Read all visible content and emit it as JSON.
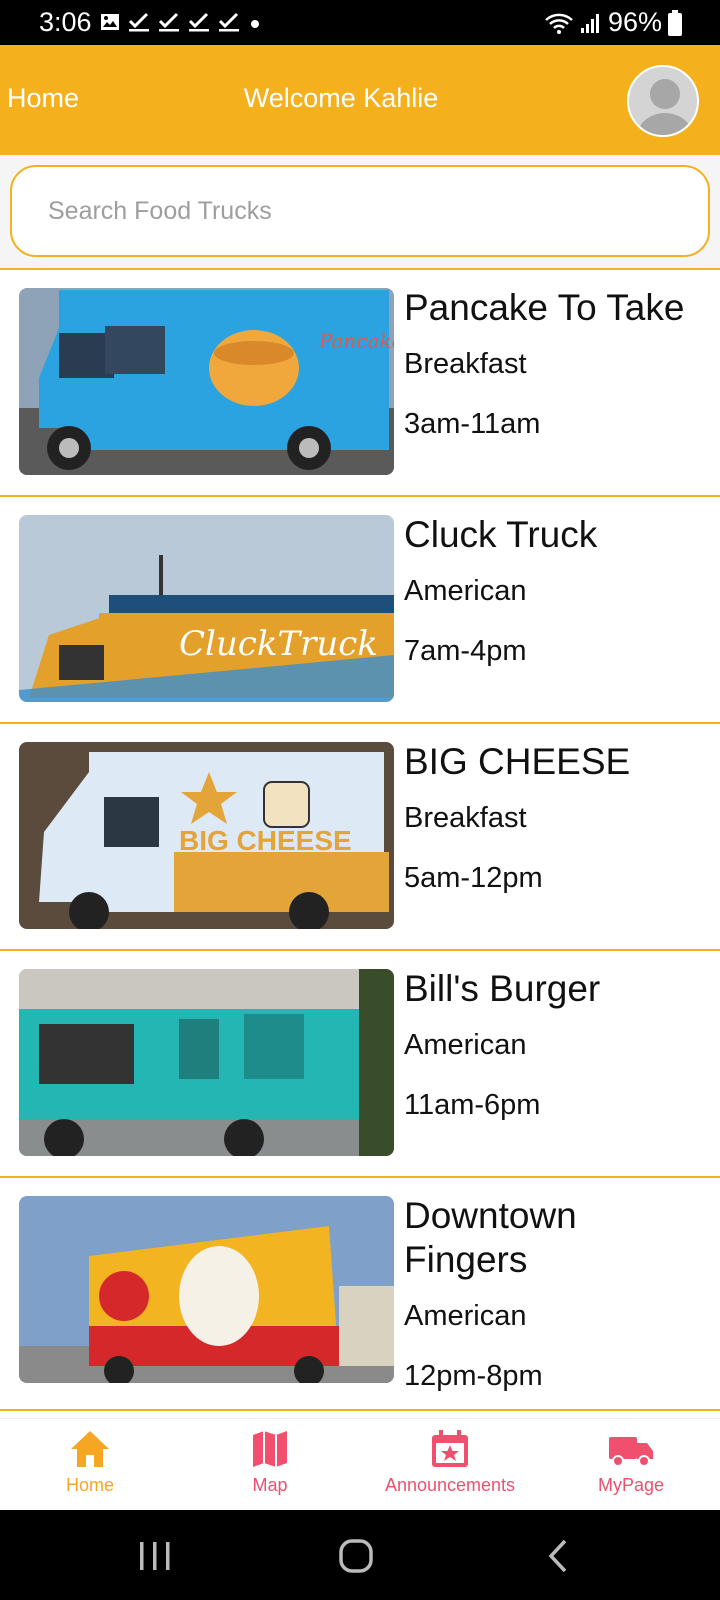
{
  "status_bar": {
    "time": "3:06",
    "battery": "96%"
  },
  "header": {
    "home_label": "Home",
    "welcome": "Welcome Kahlie"
  },
  "search": {
    "placeholder": "Search Food Trucks",
    "value": ""
  },
  "trucks": [
    {
      "name": "Pancake To Take",
      "category": "Breakfast",
      "hours": "3am-11am"
    },
    {
      "name": "Cluck Truck",
      "category": "American",
      "hours": "7am-4pm"
    },
    {
      "name": "BIG CHEESE",
      "category": "Breakfast",
      "hours": "5am-12pm"
    },
    {
      "name": "Bill's Burger",
      "category": "American",
      "hours": "11am-6pm"
    },
    {
      "name": "Downtown Fingers",
      "category": "American",
      "hours": "12pm-8pm"
    }
  ],
  "bottom_nav": [
    {
      "label": "Home",
      "icon": "home-icon",
      "active": true
    },
    {
      "label": "Map",
      "icon": "map-icon",
      "active": false
    },
    {
      "label": "Announcements",
      "icon": "calendar-star-icon",
      "active": false
    },
    {
      "label": "MyPage",
      "icon": "truck-icon",
      "active": false
    }
  ],
  "colors": {
    "accent": "#F5B01D",
    "nav_inactive": "#F0506E",
    "nav_active": "#F5A623"
  }
}
